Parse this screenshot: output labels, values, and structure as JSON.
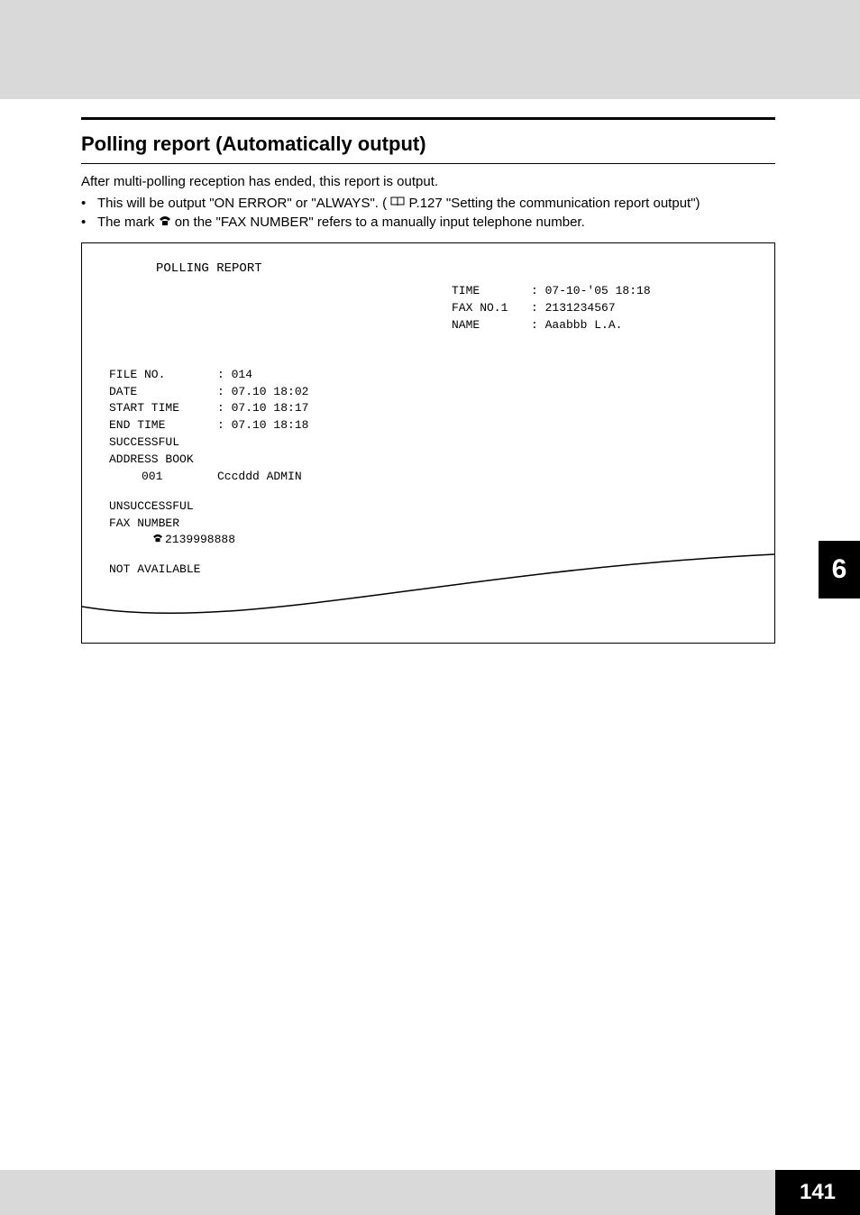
{
  "section": {
    "title": "Polling report (Automatically output)",
    "intro": "After multi-polling reception has ended, this report is output.",
    "bullet1_pre": "This will be output \"ON ERROR\" or \"ALWAYS\". (",
    "bullet1_ref": " P.127 \"Setting the communication report output\")",
    "bullet2_pre": "The mark ",
    "bullet2_post": " on the \"FAX NUMBER\" refers to a manually input telephone number."
  },
  "report": {
    "title": "POLLING REPORT",
    "time_label": "TIME",
    "time_value": ": 07-10-'05 18:18",
    "faxno_label": "FAX NO.1",
    "faxno_value": ": 2131234567",
    "name_label": "NAME",
    "name_value": ": Aaabbb L.A.",
    "file_no_label": "FILE NO.",
    "file_no_value": ": 014",
    "date_label": "DATE",
    "date_value": ": 07.10 18:02",
    "start_label": "START TIME",
    "start_value": ": 07.10 18:17",
    "end_label": "END TIME",
    "end_value": ": 07.10 18:18",
    "successful_label": "SUCCESSFUL",
    "address_book_label": "ADDRESS BOOK",
    "addr_id": "001",
    "addr_name": "Cccddd ADMIN",
    "unsuccessful_label": "UNSUCCESSFUL",
    "fax_number_label": "FAX NUMBER",
    "fax_number_value": "2139998888",
    "not_available_label": "NOT AVAILABLE"
  },
  "tab": {
    "chapter": "6"
  },
  "footer": {
    "page": "141"
  }
}
